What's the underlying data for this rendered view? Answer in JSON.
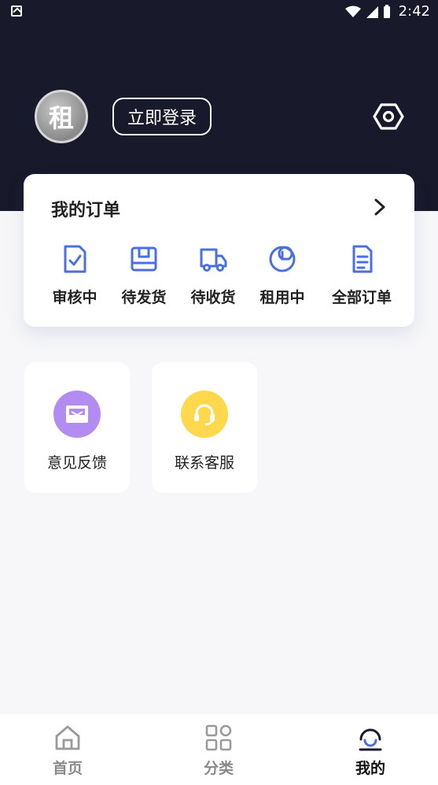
{
  "status_bar": {
    "time": "2:42"
  },
  "profile": {
    "avatar_text": "租",
    "login_label": "立即登录"
  },
  "orders": {
    "title": "我的订单",
    "items": [
      {
        "label": "审核中",
        "icon": "clipboard-check-icon"
      },
      {
        "label": "待发货",
        "icon": "package-box-icon"
      },
      {
        "label": "待收货",
        "icon": "delivery-truck-icon"
      },
      {
        "label": "租用中",
        "icon": "clock-timer-icon"
      },
      {
        "label": "全部订单",
        "icon": "document-list-icon"
      }
    ]
  },
  "features": [
    {
      "label": "意见反馈",
      "icon": "mail-inbox-icon",
      "color": "#b38cf2"
    },
    {
      "label": "联系客服",
      "icon": "headset-icon",
      "color": "#ffd84d"
    }
  ],
  "tabbar": {
    "items": [
      {
        "label": "首页",
        "icon": "home-icon"
      },
      {
        "label": "分类",
        "icon": "grid-category-icon"
      },
      {
        "label": "我的",
        "icon": "profile-icon"
      }
    ],
    "active_index": 2
  },
  "colors": {
    "header_bg": "#181a2b",
    "accent_blue": "#4a6fe0",
    "page_bg": "#f7f7f9"
  }
}
